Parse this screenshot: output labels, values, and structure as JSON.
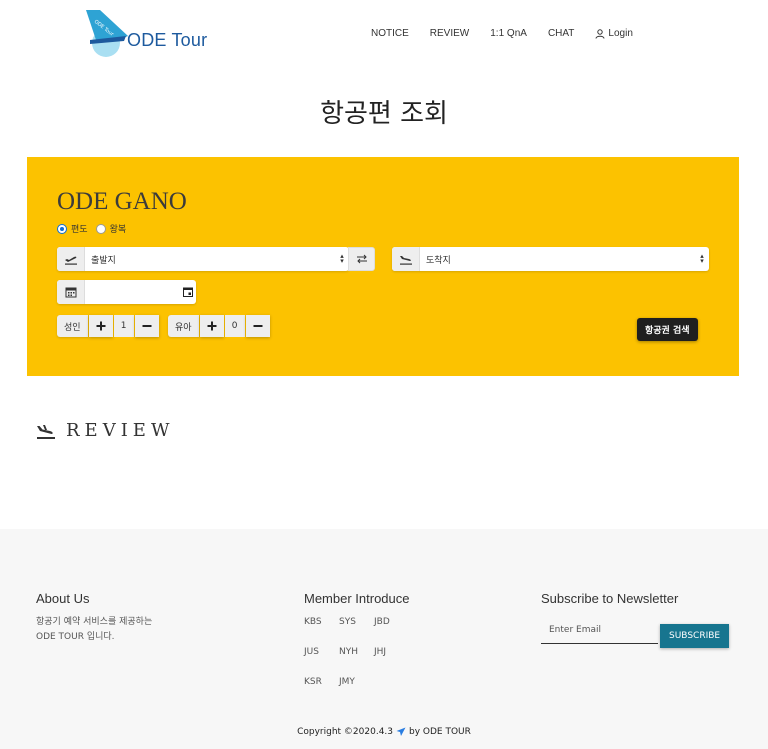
{
  "header": {
    "logo_text": "ODE Tour",
    "logo_tail_text": "ODE Tour",
    "nav": [
      "NOTICE",
      "REVIEW",
      "1:1 QnA",
      "CHAT"
    ],
    "login_label": "Login"
  },
  "page_title": "항공편 조회",
  "search": {
    "title": "ODE GANO",
    "trip_options": [
      "편도",
      "왕복"
    ],
    "selected_trip": "편도",
    "departure": {
      "value": "출발지",
      "icon": "airplane-departure-icon"
    },
    "arrival": {
      "value": "도착지",
      "icon": "airplane-arrival-icon"
    },
    "date": {
      "value": "",
      "icon": "calendar-icon"
    },
    "adult": {
      "label": "성인",
      "count": "1"
    },
    "infant": {
      "label": "유아",
      "count": "0"
    },
    "search_button": "항공권 검색",
    "panel_color": "#fcc200"
  },
  "review": {
    "title": "REVIEW"
  },
  "footer": {
    "about": {
      "heading": "About Us",
      "text_line1": "항공기 예약 서비스를 제공하는",
      "text_line2": "ODE TOUR 입니다."
    },
    "members": {
      "heading": "Member Introduce",
      "rows": [
        [
          "KBS",
          "SYS",
          "JBD"
        ],
        [
          "JUS",
          "NYH",
          "JHJ"
        ],
        [
          "KSR",
          "JMY"
        ]
      ]
    },
    "newsletter": {
      "heading": "Subscribe to Newsletter",
      "placeholder": "Enter Email",
      "button": "SUBSCRIBE"
    },
    "copyright_prefix": "Copyright ©2020.4.3",
    "copyright_suffix": "by ODE TOUR"
  },
  "colors": {
    "accent": "#17758f",
    "logo": "#1d5a9e"
  }
}
